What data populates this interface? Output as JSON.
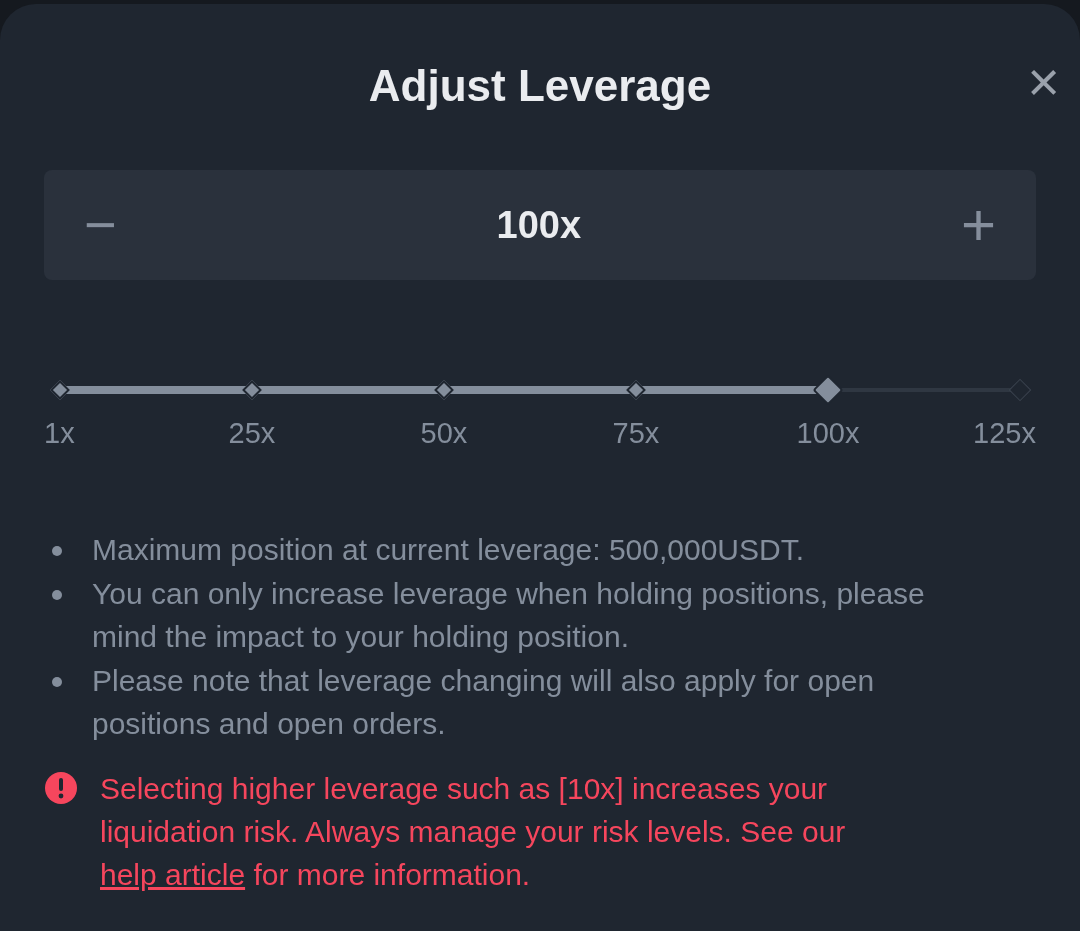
{
  "dialog": {
    "title": "Adjust Leverage",
    "close": "×"
  },
  "stepper": {
    "minus": "−",
    "value": "100x",
    "plus": "+"
  },
  "slider": {
    "level": 0.8,
    "ticks": [
      "1x",
      "25x",
      "50x",
      "75x",
      "100x",
      "125x"
    ]
  },
  "notes": [
    "Maximum position at current leverage: 500,000USDT.",
    "You can only increase leverage when holding positions, please mind the impact to your holding position.",
    "Please note that leverage changing will also apply for open positions and open orders."
  ],
  "warning": {
    "text": "Selecting higher leverage such as [10x] increases your liquidation risk. Always manage your risk levels. See our",
    "link": "help article",
    "after": "for more information."
  }
}
